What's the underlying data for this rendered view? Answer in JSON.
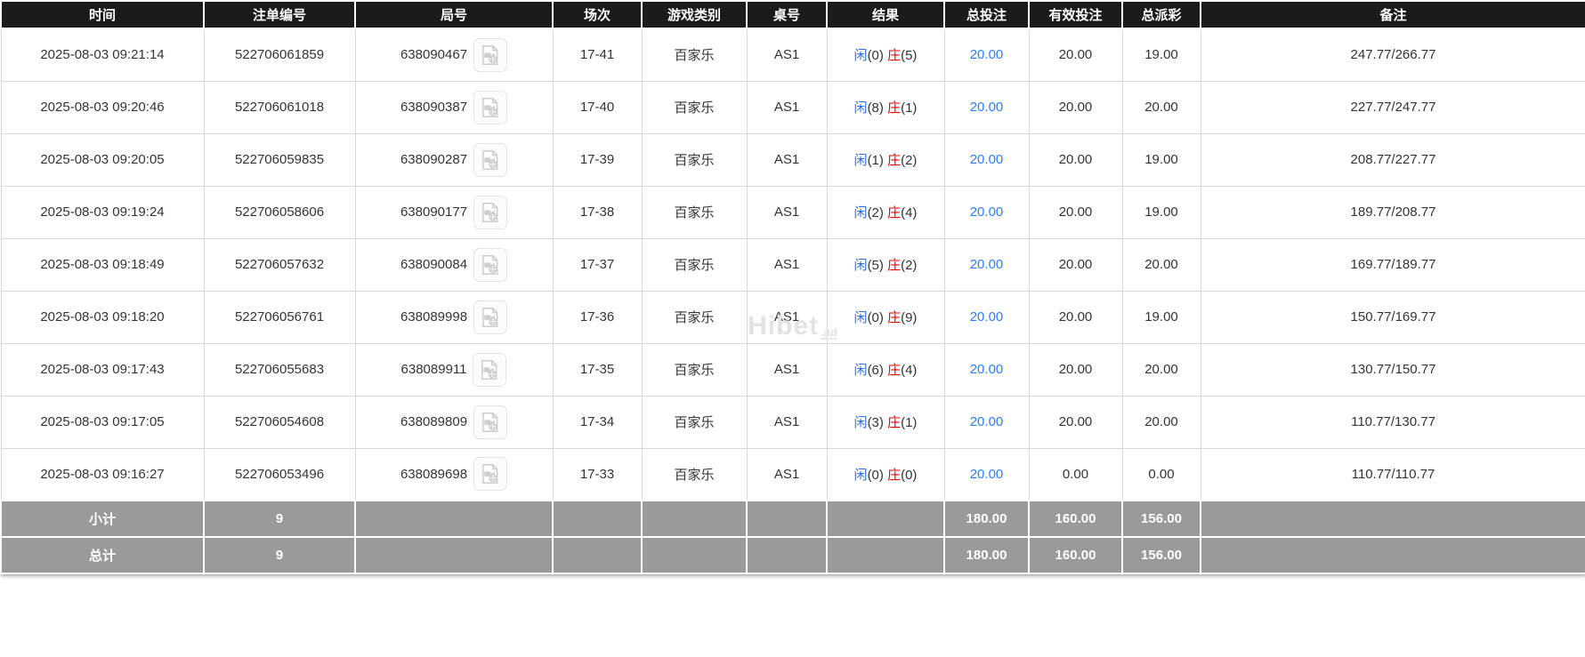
{
  "colors": {
    "header_bg": "#1b1b1b",
    "footer_bg": "#9a9a9a",
    "xian_blue": "#2b6fe0",
    "zhuang_red": "#e60000",
    "amount_link_blue": "#2b7bff"
  },
  "watermark": {
    "text": "Hibet",
    "suffix": ".ad"
  },
  "table": {
    "columns": [
      {
        "key": "time",
        "label": "时间"
      },
      {
        "key": "bet_id",
        "label": "注单编号"
      },
      {
        "key": "round_id",
        "label": "局号"
      },
      {
        "key": "session",
        "label": "场次"
      },
      {
        "key": "game",
        "label": "游戏类别"
      },
      {
        "key": "table_no",
        "label": "桌号"
      },
      {
        "key": "result",
        "label": "结果"
      },
      {
        "key": "total_bet",
        "label": "总投注"
      },
      {
        "key": "valid_bet",
        "label": "有效投注"
      },
      {
        "key": "payout",
        "label": "总派彩"
      },
      {
        "key": "remark",
        "label": "备注"
      }
    ],
    "rows": [
      {
        "time": "2025-08-03 09:21:14",
        "bet_id": "522706061859",
        "round_id": "638090467",
        "session": "17-41",
        "game": "百家乐",
        "table_no": "AS1",
        "xian_label": "闲",
        "xian_value": "(0)",
        "zhuang_label": "庄",
        "zhuang_value": "(5)",
        "total_bet": "20.00",
        "valid_bet": "20.00",
        "payout": "19.00",
        "remark": "247.77/266.77"
      },
      {
        "time": "2025-08-03 09:20:46",
        "bet_id": "522706061018",
        "round_id": "638090387",
        "session": "17-40",
        "game": "百家乐",
        "table_no": "AS1",
        "xian_label": "闲",
        "xian_value": "(8)",
        "zhuang_label": "庄",
        "zhuang_value": "(1)",
        "total_bet": "20.00",
        "valid_bet": "20.00",
        "payout": "20.00",
        "remark": "227.77/247.77"
      },
      {
        "time": "2025-08-03 09:20:05",
        "bet_id": "522706059835",
        "round_id": "638090287",
        "session": "17-39",
        "game": "百家乐",
        "table_no": "AS1",
        "xian_label": "闲",
        "xian_value": "(1)",
        "zhuang_label": "庄",
        "zhuang_value": "(2)",
        "total_bet": "20.00",
        "valid_bet": "20.00",
        "payout": "19.00",
        "remark": "208.77/227.77"
      },
      {
        "time": "2025-08-03 09:19:24",
        "bet_id": "522706058606",
        "round_id": "638090177",
        "session": "17-38",
        "game": "百家乐",
        "table_no": "AS1",
        "xian_label": "闲",
        "xian_value": "(2)",
        "zhuang_label": "庄",
        "zhuang_value": "(4)",
        "total_bet": "20.00",
        "valid_bet": "20.00",
        "payout": "19.00",
        "remark": "189.77/208.77"
      },
      {
        "time": "2025-08-03 09:18:49",
        "bet_id": "522706057632",
        "round_id": "638090084",
        "session": "17-37",
        "game": "百家乐",
        "table_no": "AS1",
        "xian_label": "闲",
        "xian_value": "(5)",
        "zhuang_label": "庄",
        "zhuang_value": "(2)",
        "total_bet": "20.00",
        "valid_bet": "20.00",
        "payout": "20.00",
        "remark": "169.77/189.77"
      },
      {
        "time": "2025-08-03 09:18:20",
        "bet_id": "522706056761",
        "round_id": "638089998",
        "session": "17-36",
        "game": "百家乐",
        "table_no": "AS1",
        "xian_label": "闲",
        "xian_value": "(0)",
        "zhuang_label": "庄",
        "zhuang_value": "(9)",
        "total_bet": "20.00",
        "valid_bet": "20.00",
        "payout": "19.00",
        "remark": "150.77/169.77"
      },
      {
        "time": "2025-08-03 09:17:43",
        "bet_id": "522706055683",
        "round_id": "638089911",
        "session": "17-35",
        "game": "百家乐",
        "table_no": "AS1",
        "xian_label": "闲",
        "xian_value": "(6)",
        "zhuang_label": "庄",
        "zhuang_value": "(4)",
        "total_bet": "20.00",
        "valid_bet": "20.00",
        "payout": "20.00",
        "remark": "130.77/150.77"
      },
      {
        "time": "2025-08-03 09:17:05",
        "bet_id": "522706054608",
        "round_id": "638089809",
        "session": "17-34",
        "game": "百家乐",
        "table_no": "AS1",
        "xian_label": "闲",
        "xian_value": "(3)",
        "zhuang_label": "庄",
        "zhuang_value": "(1)",
        "total_bet": "20.00",
        "valid_bet": "20.00",
        "payout": "20.00",
        "remark": "110.77/130.77"
      },
      {
        "time": "2025-08-03 09:16:27",
        "bet_id": "522706053496",
        "round_id": "638089698",
        "session": "17-33",
        "game": "百家乐",
        "table_no": "AS1",
        "xian_label": "闲",
        "xian_value": "(0)",
        "zhuang_label": "庄",
        "zhuang_value": "(0)",
        "total_bet": "20.00",
        "valid_bet": "0.00",
        "payout": "0.00",
        "remark": "110.77/110.77"
      }
    ],
    "subtotal": {
      "label": "小计",
      "count": "9",
      "total_bet": "180.00",
      "valid_bet": "160.00",
      "payout": "156.00"
    },
    "total": {
      "label": "总计",
      "count": "9",
      "total_bet": "180.00",
      "valid_bet": "160.00",
      "payout": "156.00"
    }
  }
}
